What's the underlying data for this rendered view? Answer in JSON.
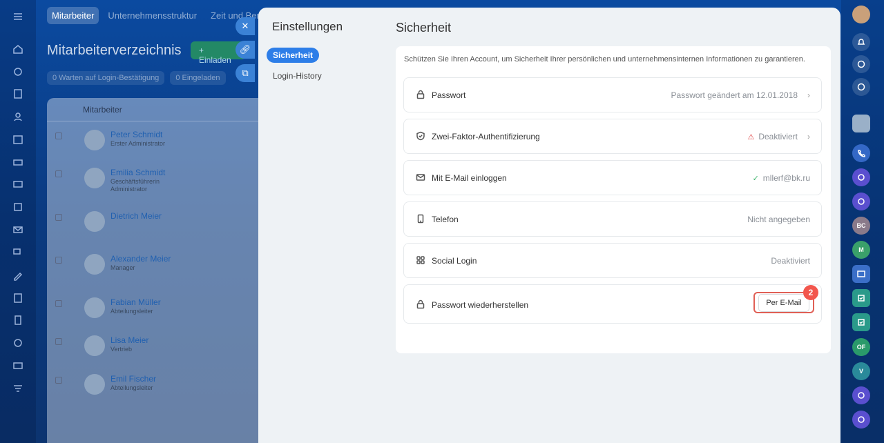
{
  "topnav": {
    "items": [
      "Mitarbeiter",
      "Unternehmensstruktur",
      "Zeit und Bericht"
    ]
  },
  "background": {
    "page_title": "Mitarbeiterverzeichnis",
    "invite_label": "+ Einladen",
    "filters": [
      "0  Warten auf Login-Bestätigung",
      "0  Eingeladen"
    ],
    "table_header": "Mitarbeiter",
    "employees": [
      {
        "name": "Peter Schmidt",
        "role": "Erster Administrator"
      },
      {
        "name": "Emilia Schmidt",
        "role": "Geschäftsführerin Administrator"
      },
      {
        "name": "Dietrich Meier",
        "role": ""
      },
      {
        "name": "Alexander Meier",
        "role": "Manager"
      },
      {
        "name": "Fabian Müller",
        "role": "Abteilungsleiter"
      },
      {
        "name": "Lisa Meier",
        "role": "Vertrieb"
      },
      {
        "name": "Emil Fischer",
        "role": "Abteilungsleiter"
      }
    ]
  },
  "settings": {
    "title": "Einstellungen",
    "menu": [
      {
        "label": "Sicherheit",
        "active": true
      },
      {
        "label": "Login-History",
        "active": false
      }
    ]
  },
  "security": {
    "title": "Sicherheit",
    "description": "Schützen Sie Ihren Account, um Sicherheit Ihrer persönlichen und unternehmensinternen Informationen zu garantieren.",
    "rows": [
      {
        "icon": "lock-icon",
        "label": "Passwort",
        "value": "Passwort geändert am 12.01.2018"
      },
      {
        "icon": "shield-icon",
        "label": "Zwei-Faktor-Authentifizierung",
        "value": "Deaktiviert",
        "status": "warning"
      },
      {
        "icon": "mail-icon",
        "label": "Mit E-Mail einloggen",
        "value": "mllerf@bk.ru",
        "status": "ok"
      },
      {
        "icon": "phone-icon",
        "label": "Telefon",
        "value": "Nicht angegeben"
      },
      {
        "icon": "grid-icon",
        "label": "Social Login",
        "value": "Deaktiviert"
      },
      {
        "icon": "lock-icon",
        "label": "Passwort wiederherstellen",
        "button": "Per E-Mail"
      }
    ],
    "step_badge": "2"
  },
  "right_rail": {
    "avatars": [
      "BC",
      "M",
      "OF",
      "V"
    ]
  },
  "colors": {
    "accent": "#2d7ee8",
    "warning": "#e24b4b",
    "ok": "#3bb36a",
    "highlight": "#e05f55"
  }
}
